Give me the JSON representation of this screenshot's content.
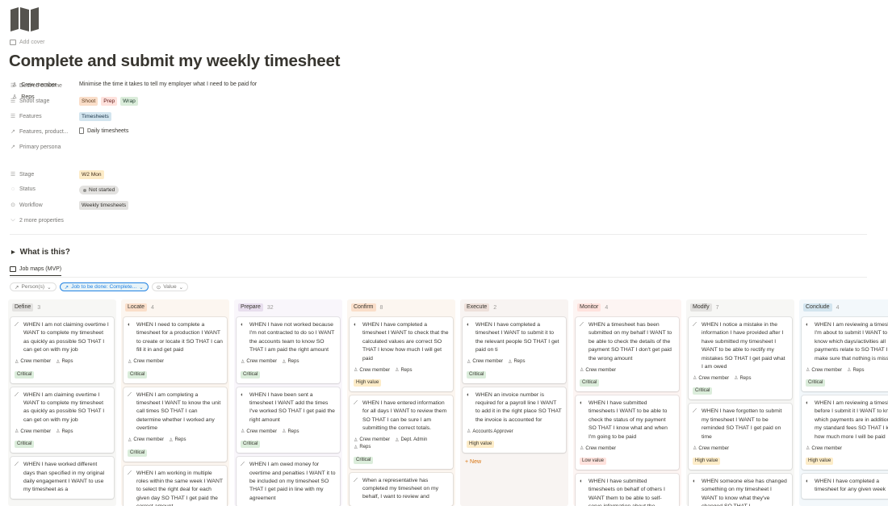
{
  "page": {
    "icon": "map-icon",
    "add_cover": "Add cover",
    "title": "Complete and submit my weekly timesheet"
  },
  "properties": {
    "desired_outcome": {
      "label": "Desired outcome",
      "value": "Minimise the time it takes to tell my employer what I need to be paid for"
    },
    "shoot_stage": {
      "label": "Shoot stage",
      "tags": [
        "Shoot",
        "Prep",
        "Wrap"
      ]
    },
    "features": {
      "label": "Features",
      "tags": [
        "Timesheets"
      ]
    },
    "features_product": {
      "label": "Features, product...",
      "value": "Daily timesheets"
    },
    "primary_persona": {
      "label": "Primary persona",
      "values": [
        "Crew member",
        "Reps"
      ]
    },
    "stage": {
      "label": "Stage",
      "value": "W2 Mon"
    },
    "status": {
      "label": "Status",
      "value": "Not started"
    },
    "workflow": {
      "label": "Workflow",
      "value": "Weekly timesheets"
    },
    "more": "2 more properties"
  },
  "toggle": {
    "label": "What is this?"
  },
  "view": {
    "tab": "Job maps (MVP)"
  },
  "filters": {
    "persona": "Person(s)",
    "job": "Job to be done: Complete...",
    "value": "Value"
  },
  "colors": {
    "define": "#e3e2e0",
    "locate": "#fadec9",
    "prepare": "#e8deee",
    "confirm": "#fadec9",
    "execute": "#eee0da",
    "monitor": "#ffe2dd",
    "modify": "#e3e2e0",
    "conclude": "#d3e5ef",
    "critical": "#dbeddb",
    "high_value": "#fdecc8",
    "low_value": "#ffe2dd"
  },
  "board": {
    "new_label": "New",
    "columns": [
      {
        "name": "Define",
        "count": "3",
        "cards": [
          {
            "icon": "wand-icon",
            "text": "WHEN I am not claiming overtime I WANT to complete my timesheet as quickly as possible SO THAT I can get on with my job",
            "people": [
              "Crew member",
              "Reps"
            ],
            "tag": "Critical"
          },
          {
            "icon": "wand-icon",
            "text": "WHEN I am claiming overtime I WANT to complete my timesheet as quickly as possible SO THAT I can get on with my job",
            "people": [
              "Crew member",
              "Reps"
            ],
            "tag": "Critical"
          },
          {
            "icon": "wand-icon",
            "text": "WHEN I have worked different days than specified in my original daily engagement I WANT to use my timesheet as a",
            "people": [],
            "tag": ""
          }
        ]
      },
      {
        "name": "Locate",
        "count": "4",
        "cards": [
          {
            "icon": "half-circle-icon",
            "text": "WHEN I need to complete a timesheet for a production I WANT to create or locate it SO THAT I can fill it in and get paid",
            "people": [
              "Crew member"
            ],
            "tag": "Critical"
          },
          {
            "icon": "wand-icon",
            "text": "WHEN I am completing a timesheet I WANT to know the unit call times SO THAT I can determine whether I worked any overtime",
            "people": [
              "Crew member",
              "Reps"
            ],
            "tag": "Critical"
          },
          {
            "icon": "wand-icon",
            "text": "WHEN I am working in multiple roles within the same week I WANT to select the right deal for each given day SO THAT I get paid the correct amount",
            "people": [],
            "tag": ""
          }
        ]
      },
      {
        "name": "Prepare",
        "count": "32",
        "cards": [
          {
            "icon": "half-circle-icon",
            "text": "WHEN I have not worked because I'm not contracted to do so I WANT the accounts team to know SO THAT I am paid the right amount",
            "people": [
              "Crew member",
              "Reps"
            ],
            "tag": "Critical"
          },
          {
            "icon": "half-circle-icon",
            "text": "WHEN I have been sent a timesheet I WANT add the times I've worked SO THAT I get paid the right amount",
            "people": [
              "Crew member",
              "Reps"
            ],
            "tag": "Critical"
          },
          {
            "icon": "wand-icon",
            "text": "WHEN I am owed money for overtime and penalties I WANT it to be included on my timesheet SO THAT I get paid in line with my agreement",
            "people": [],
            "tag": ""
          }
        ]
      },
      {
        "name": "Confirm",
        "count": "8",
        "cards": [
          {
            "icon": "half-circle-icon",
            "text": "WHEN I have completed a timesheet I WANT to check that the calculated values are correct SO THAT I know how much I will get paid",
            "people": [
              "Crew member",
              "Reps"
            ],
            "tag": "High value"
          },
          {
            "icon": "wand-icon",
            "text": "WHEN I have entered information for all days I WANT to review them SO THAT I can be sure I am submitting the correct totals.",
            "people": [
              "Crew member",
              "Dept. Admin",
              "Reps"
            ],
            "tag": "Critical"
          },
          {
            "icon": "wand-icon",
            "text": "When a representative has completed my timesheet on my behalf, I want to review and",
            "people": [],
            "tag": ""
          }
        ]
      },
      {
        "name": "Execute",
        "count": "2",
        "cards": [
          {
            "icon": "half-circle-icon",
            "text": "WHEN I have completed a timesheet I WANT to submit it to the relevant people SO THAT I get paid on ti",
            "people": [
              "Crew member",
              "Reps"
            ],
            "tag": "Critical"
          },
          {
            "icon": "half-circle-icon",
            "text": "WHEN an invoice number is required for a payroll line I WANT to add it in the right place SO THAT the invoice is accounted for",
            "people": [
              "Accounts Approver"
            ],
            "tag": "High value"
          }
        ]
      },
      {
        "name": "Monitor",
        "count": "4",
        "cards": [
          {
            "icon": "wand-icon",
            "text": "WHEN a timesheet has been submitted on my behalf I WANT to be able to check the details of the payment SO THAT I don't get paid the wrong amount",
            "people": [
              "Crew member"
            ],
            "tag": "Critical"
          },
          {
            "icon": "half-circle-icon",
            "text": "WHEN I have submitted timesheets I WANT to be able to check the status of my payment SO THAT I know what and when I'm going to be paid",
            "people": [
              "Crew member"
            ],
            "tag": "Low value"
          },
          {
            "icon": "half-circle-icon",
            "text": "WHEN I have submitted timesheets on behalf of others I WANT them to be able to self-serve information about the",
            "people": [],
            "tag": ""
          }
        ]
      },
      {
        "name": "Modify",
        "count": "7",
        "cards": [
          {
            "icon": "wand-icon",
            "text": "WHEN I notice a mistake in the information I have provided after I have submitted my timesheet I WANT to be able to rectify my mistakes SO THAT I get paid what I am owed",
            "people": [
              "Crew member",
              "Reps"
            ],
            "tag": "Critical"
          },
          {
            "icon": "wand-icon",
            "text": "WHEN I have forgotten to submit my timesheet I WANT to be reminded SO THAT I get paid on time",
            "people": [
              "Crew member"
            ],
            "tag": "High value"
          },
          {
            "icon": "half-circle-icon",
            "text": "WHEN someone else has changed something on my timesheet I WANT to know what they've changed SO THAT I",
            "people": [],
            "tag": ""
          }
        ]
      },
      {
        "name": "Conclude",
        "count": "4",
        "cards": [
          {
            "icon": "half-circle-icon",
            "text": "WHEN I am reviewing a timesheet I'm about to submit I WANT to know which days/activities all payments relate to SO THAT I can make sure that nothing is missing",
            "people": [
              "Crew member",
              "Reps"
            ],
            "tag": "Critical"
          },
          {
            "icon": "half-circle-icon",
            "text": "WHEN I am reviewing a timesheet before I submit it I WANT to know which payments are in addition to my standard fees SO THAT I know how much more I will be paid",
            "people": [
              "Crew member"
            ],
            "tag": "High value"
          },
          {
            "icon": "half-circle-icon",
            "text": "WHEN I have completed a timesheet for any given week",
            "people": [],
            "tag": ""
          }
        ]
      }
    ]
  }
}
